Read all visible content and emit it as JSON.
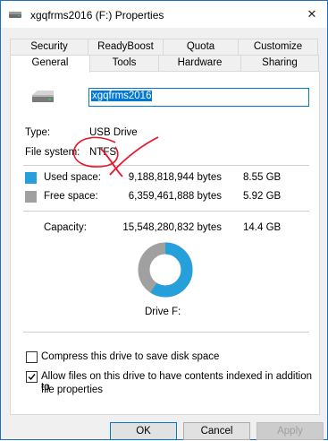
{
  "window": {
    "title": "xgqfrms2016 (F:) Properties",
    "close_glyph": "✕"
  },
  "tabs": {
    "top_row": [
      "Security",
      "ReadyBoost",
      "Quota",
      "Customize"
    ],
    "bottom_row": [
      "General",
      "Tools",
      "Hardware",
      "Sharing"
    ],
    "active": "General"
  },
  "general": {
    "drive_name": "xgqfrms2016",
    "type_label": "Type:",
    "type_value": "USB Drive",
    "fs_label": "File system:",
    "fs_value": "NTFS",
    "used_label": "Used space:",
    "used_bytes": "9,188,818,944 bytes",
    "used_size": "8.55 GB",
    "free_label": "Free space:",
    "free_bytes": "6,359,461,888 bytes",
    "free_size": "5.92 GB",
    "capacity_label": "Capacity:",
    "capacity_bytes": "15,548,280,832 bytes",
    "capacity_size": "14.4 GB",
    "drive_caption": "Drive F:",
    "used_fraction": 0.591,
    "used_color": "#26a0da",
    "free_color": "#a0a0a0"
  },
  "options": {
    "compress_label": "Compress this drive to save disk space",
    "compress_checked": false,
    "index_label_line1": "Allow files on this drive to have contents indexed in addition to",
    "index_label_line2": "file properties",
    "index_checked": true
  },
  "buttons": {
    "ok": "OK",
    "cancel": "Cancel",
    "apply": "Apply"
  },
  "annotation": {
    "color": "#e8132a"
  }
}
